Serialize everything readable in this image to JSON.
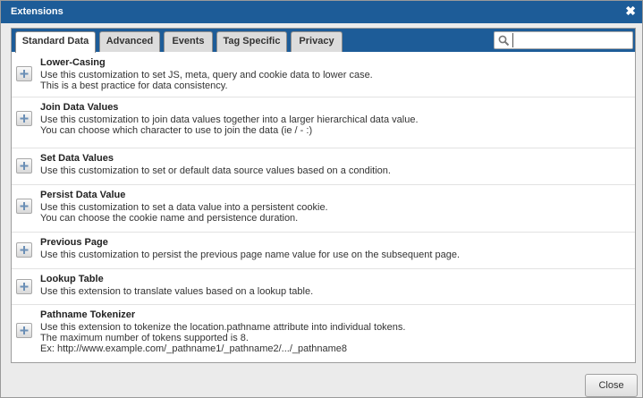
{
  "dialog": {
    "title": "Extensions",
    "close_glyph": "✖"
  },
  "tabs": [
    {
      "label": "Standard Data",
      "active": true
    },
    {
      "label": "Advanced",
      "active": false
    },
    {
      "label": "Events",
      "active": false
    },
    {
      "label": "Tag Specific",
      "active": false
    },
    {
      "label": "Privacy",
      "active": false
    }
  ],
  "search": {
    "value": "",
    "placeholder": ""
  },
  "extensions": [
    {
      "title": "Lower-Casing",
      "lines": [
        "Use this customization to set JS, meta, query and cookie data to lower case.",
        "This is a best practice for data consistency."
      ]
    },
    {
      "title": "Join Data Values",
      "lines": [
        "Use this customization to join data values together into a larger hierarchical data value.",
        "You can choose which character to use to join the data (ie / - :)"
      ]
    },
    {
      "title": "Set Data Values",
      "lines": [
        "Use this customization to set or default data source values based on a condition."
      ]
    },
    {
      "title": "Persist Data Value",
      "lines": [
        "Use this customization to set a data value into a persistent cookie.",
        "You can choose the cookie name and persistence duration."
      ]
    },
    {
      "title": "Previous Page",
      "lines": [
        "Use this customization to persist the previous page name value for use on the subsequent page."
      ]
    },
    {
      "title": "Lookup Table",
      "lines": [
        "Use this extension to translate values based on a lookup table."
      ]
    },
    {
      "title": "Pathname Tokenizer",
      "lines": [
        "Use this extension to tokenize the location.pathname attribute into individual tokens.",
        "The maximum number of tokens supported is 8.",
        "Ex: http://www.example.com/_pathname1/_pathname2/.../_pathname8"
      ]
    }
  ],
  "footer": {
    "close_label": "Close"
  },
  "colors": {
    "titlebar": "#1d5c98",
    "tab_active": "#ffffff",
    "tab_inactive": "#dcdcdc"
  }
}
